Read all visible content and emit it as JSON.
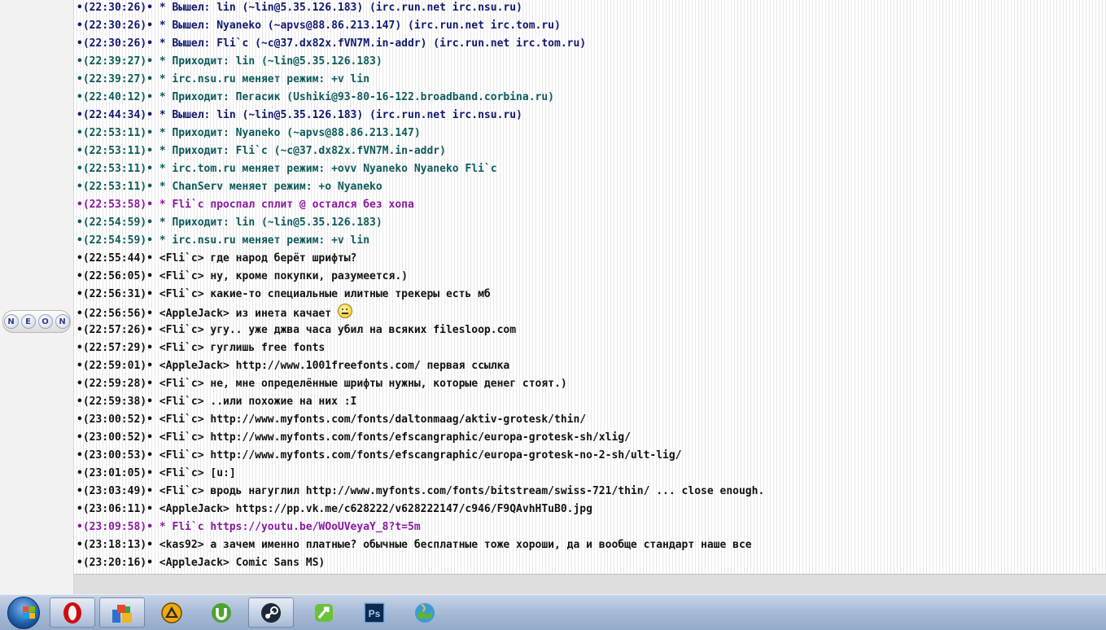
{
  "left_panel": {
    "logo_letters": [
      "N",
      "E",
      "O",
      "N"
    ]
  },
  "chat": {
    "lines": [
      {
        "ts": "•(22:30:26)•",
        "text": "* Вышел: lin (~lin@5.35.126.183) (irc.run.net irc.nsu.ru)",
        "kind": "quit"
      },
      {
        "ts": "•(22:30:26)•",
        "text": "* Вышел: Nyaneko (~apvs@88.86.213.147) (irc.run.net irc.tom.ru)",
        "kind": "quit"
      },
      {
        "ts": "•(22:30:26)•",
        "text": "* Вышел: Fli`c (~c@37.dx82x.fVN7M.in-addr) (irc.run.net irc.tom.ru)",
        "kind": "quit"
      },
      {
        "ts": "•(22:39:27)•",
        "text": "* Приходит: lin (~lin@5.35.126.183)",
        "kind": "join"
      },
      {
        "ts": "•(22:39:27)•",
        "text": "* irc.nsu.ru меняет режим: +v lin",
        "kind": "join"
      },
      {
        "ts": "•(22:40:12)•",
        "text": "* Приходит: Пегасик (Ushiki@93-80-16-122.broadband.corbina.ru)",
        "kind": "join"
      },
      {
        "ts": "•(22:44:34)•",
        "text": "* Вышел: lin (~lin@5.35.126.183) (irc.run.net irc.nsu.ru)",
        "kind": "quit"
      },
      {
        "ts": "•(22:53:11)•",
        "text": "* Приходит: Nyaneko (~apvs@88.86.213.147)",
        "kind": "join"
      },
      {
        "ts": "•(22:53:11)•",
        "text": "* Приходит: Fli`c (~c@37.dx82x.fVN7M.in-addr)",
        "kind": "join"
      },
      {
        "ts": "•(22:53:11)•",
        "text": "* irc.tom.ru меняет режим: +ovv Nyaneko Nyaneko Fli`c",
        "kind": "join"
      },
      {
        "ts": "•(22:53:11)•",
        "text": "* ChanServ меняет режим: +o Nyaneko",
        "kind": "join"
      },
      {
        "ts": "•(22:53:58)•",
        "text": "* Fli`c проспал сплит @ остался без хопа",
        "kind": "action"
      },
      {
        "ts": "•(22:54:59)•",
        "text": "* Приходит: lin (~lin@5.35.126.183)",
        "kind": "join"
      },
      {
        "ts": "•(22:54:59)•",
        "text": "* irc.nsu.ru меняет режим: +v lin",
        "kind": "join"
      },
      {
        "ts": "•(22:55:44)•",
        "text": "<Fli`c> где народ берёт шрифты?",
        "kind": "msg"
      },
      {
        "ts": "•(22:56:05)•",
        "text": "<Fli`c> ну, кроме покупки, разумеется.)",
        "kind": "msg"
      },
      {
        "ts": "•(22:56:31)•",
        "text": "<Fli`c> какие-то специальные илитные трекеры есть мб",
        "kind": "msg"
      },
      {
        "ts": "•(22:56:56)•",
        "text": "<AppleJack> из инета качает",
        "kind": "msg",
        "emoji": true
      },
      {
        "ts": "•(22:57:26)•",
        "text": "<Fli`c> угу.. уже джва часа убил на всяких filesloop.com",
        "kind": "msg"
      },
      {
        "ts": "•(22:57:29)•",
        "text": "<Fli`c> гуглишь free fonts",
        "kind": "msg"
      },
      {
        "ts": "•(22:59:01)•",
        "text": "<AppleJack> http://www.1001freefonts.com/ первая ссылка",
        "kind": "msg"
      },
      {
        "ts": "•(22:59:28)•",
        "text": "<Fli`c> не, мне определённые шрифты нужны, которые денег стоят.)",
        "kind": "msg"
      },
      {
        "ts": "•(22:59:38)•",
        "text": "<Fli`c> ..или похожие на них :I",
        "kind": "msg"
      },
      {
        "ts": "•(23:00:52)•",
        "text": "<Fli`c> http://www.myfonts.com/fonts/daltonmaag/aktiv-grotesk/thin/",
        "kind": "msg"
      },
      {
        "ts": "•(23:00:52)•",
        "text": "<Fli`c> http://www.myfonts.com/fonts/efscangraphic/europa-grotesk-sh/xlig/",
        "kind": "msg"
      },
      {
        "ts": "•(23:00:53)•",
        "text": "<Fli`c> http://www.myfonts.com/fonts/efscangraphic/europa-grotesk-no-2-sh/ult-lig/",
        "kind": "msg"
      },
      {
        "ts": "•(23:01:05)•",
        "text": "<Fli`c> [u:]",
        "kind": "msg"
      },
      {
        "ts": "•(23:03:49)•",
        "text": "<Fli`c> вродь нагуглил http://www.myfonts.com/fonts/bitstream/swiss-721/thin/ ... close enough.",
        "kind": "msg"
      },
      {
        "ts": "•(23:06:11)•",
        "text": "<AppleJack> https://pp.vk.me/c628222/v628222147/c946/F9QAvhHTuB0.jpg",
        "kind": "msg"
      },
      {
        "ts": "•(23:09:58)•",
        "text": "* Fli`c https://youtu.be/WOoUVeyaY_8?t=5m",
        "kind": "action"
      },
      {
        "ts": "•(23:18:13)•",
        "text": "<kas92> а зачем именно платные? обычные бесплатные тоже хороши, да и вообще стандарт наше все",
        "kind": "msg"
      },
      {
        "ts": "•(23:20:16)•",
        "text": "<AppleJack> Comic Sans MS)",
        "kind": "msg"
      }
    ]
  },
  "input": {
    "value": ""
  },
  "taskbar": {
    "items": [
      {
        "name": "opera",
        "icon": "opera-icon",
        "open": true
      },
      {
        "name": "app-blocks",
        "icon": "blocks-icon",
        "open": true
      },
      {
        "name": "amip",
        "icon": "triangle-app-icon",
        "open": false
      },
      {
        "name": "utorrent",
        "icon": "utorrent-icon",
        "open": false
      },
      {
        "name": "steam",
        "icon": "steam-icon",
        "open": true
      },
      {
        "name": "green-app",
        "icon": "green-wrench-icon",
        "open": false
      },
      {
        "name": "photoshop",
        "icon": "photoshop-icon",
        "label": "Ps",
        "open": false
      },
      {
        "name": "map-app",
        "icon": "globe-map-icon",
        "open": false
      }
    ]
  },
  "colors": {
    "quit": "#10186e",
    "join": "#0d5a5a",
    "action": "#8a1a9e",
    "msg": "#111111"
  }
}
